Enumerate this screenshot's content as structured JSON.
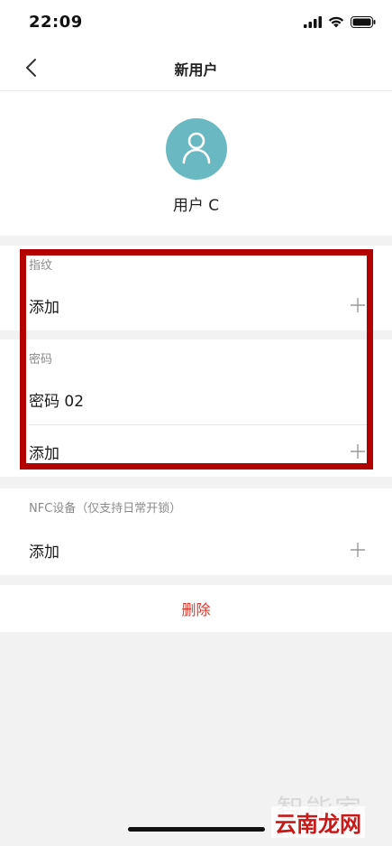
{
  "status_bar": {
    "time": "22:09",
    "icons": [
      "signal-icon",
      "wifi-icon",
      "battery-icon"
    ]
  },
  "nav": {
    "title": "新用户",
    "back_icon": "chevron-left-icon"
  },
  "profile": {
    "avatar_icon": "user-icon",
    "avatar_color": "#6ab9c2",
    "name": "用户 C"
  },
  "fingerprint": {
    "label": "指纹",
    "add_label": "添加"
  },
  "password": {
    "label": "密码",
    "items": [
      "密码 02"
    ],
    "add_label": "添加"
  },
  "nfc": {
    "label": "NFC设备（仅支持日常开锁）",
    "add_label": "添加"
  },
  "delete": {
    "label": "删除",
    "color": "#e0342a"
  },
  "watermark": {
    "text": "智能家",
    "site": "云南龙网"
  },
  "highlight_color": "#b30000"
}
